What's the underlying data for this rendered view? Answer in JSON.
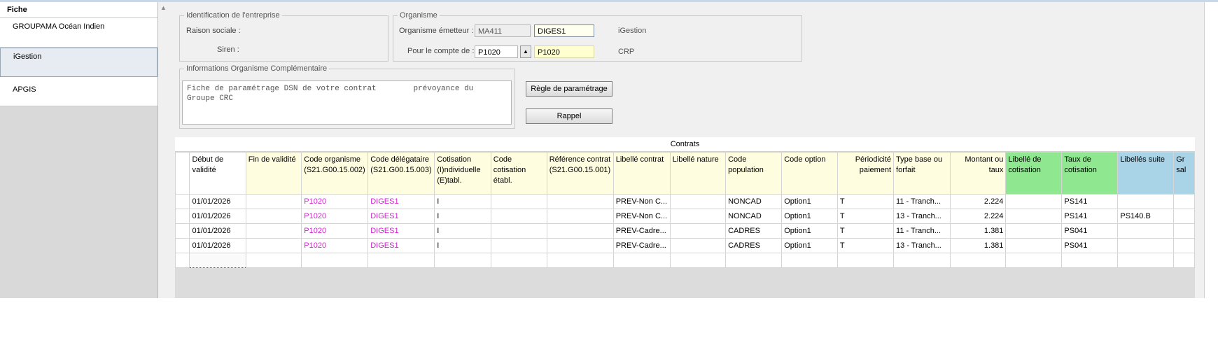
{
  "left_panel": {
    "header": "Fiche",
    "items": [
      {
        "label": "GROUPAMA Océan Indien",
        "selected": false
      },
      {
        "label": "iGestion",
        "selected": true
      },
      {
        "label": "APGIS",
        "selected": false
      }
    ]
  },
  "company": {
    "legend": "Identification de l'entreprise",
    "raison_sociale_label": "Raison sociale :",
    "siren_label": "Siren :"
  },
  "organisme": {
    "legend": "Organisme",
    "emetteur_label": "Organisme émetteur :",
    "emetteur_code": "MA411",
    "emetteur_value": "DIGES1",
    "emetteur_name": "iGestion",
    "compte_label": "Pour le compte de :",
    "compte_code": "P1020",
    "compte_value": "P1020",
    "compte_name": "CRP"
  },
  "info": {
    "legend": "Informations Organisme Complémentaire",
    "text": "Fiche de paramétrage DSN de votre contrat        prévoyance du\nGroupe CRC"
  },
  "buttons": {
    "regle": "Règle de paramétrage",
    "rappel": "Rappel"
  },
  "grid": {
    "title": "Contrats",
    "columns": [
      {
        "label": "",
        "color": "white"
      },
      {
        "label": "Début de validité",
        "color": "white"
      },
      {
        "label": "Fin de validité",
        "color": "yellow"
      },
      {
        "label": "Code organisme (S21.G00.15.002)",
        "color": "yellow"
      },
      {
        "label": "Code délégataire (S21.G00.15.003)",
        "color": "yellow"
      },
      {
        "label": "Cotisation (I)ndividuelle (E)tabl.",
        "color": "yellow"
      },
      {
        "label": "Code cotisation établ.",
        "color": "yellow"
      },
      {
        "label": "Référence contrat (S21.G00.15.001)",
        "color": "yellow"
      },
      {
        "label": "Libellé contrat",
        "color": "yellow"
      },
      {
        "label": "Libellé nature",
        "color": "yellow"
      },
      {
        "label": "Code population",
        "color": "yellow"
      },
      {
        "label": "Code option",
        "color": "yellow"
      },
      {
        "label": "Périodicité paiement",
        "color": "yellow"
      },
      {
        "label": "Type base ou forfait",
        "color": "yellow"
      },
      {
        "label": "Montant ou taux",
        "color": "yellow"
      },
      {
        "label": "Libellé de cotisation",
        "color": "green"
      },
      {
        "label": "Taux de cotisation",
        "color": "green"
      },
      {
        "label": "Libellés suite",
        "color": "blue"
      },
      {
        "label": "Gr sal",
        "color": "blue"
      }
    ],
    "rows": [
      [
        "",
        "01/01/2026",
        "",
        "P1020",
        "DIGES1",
        "I",
        "",
        "",
        "PREV-Non C...",
        "",
        "NONCAD",
        "Option1",
        "T",
        "11 - Tranch...",
        "2.224",
        "",
        "PS141",
        "",
        ""
      ],
      [
        "",
        "01/01/2026",
        "",
        "P1020",
        "DIGES1",
        "I",
        "",
        "",
        "PREV-Non C...",
        "",
        "NONCAD",
        "Option1",
        "T",
        "13 - Tranch...",
        "2.224",
        "",
        "PS141",
        "PS140.B",
        ""
      ],
      [
        "",
        "01/01/2026",
        "",
        "P1020",
        "DIGES1",
        "I",
        "",
        "",
        "PREV-Cadre...",
        "",
        "CADRES",
        "Option1",
        "T",
        "11 - Tranch...",
        "1.381",
        "",
        "PS041",
        "",
        ""
      ],
      [
        "",
        "01/01/2026",
        "",
        "P1020",
        "DIGES1",
        "I",
        "",
        "",
        "PREV-Cadre...",
        "",
        "CADRES",
        "Option1",
        "T",
        "13 - Tranch...",
        "1.381",
        "",
        "PS041",
        "",
        ""
      ],
      [
        "",
        "",
        "",
        "",
        "",
        "",
        "",
        "",
        "",
        "",
        "",
        "",
        "",
        "",
        "",
        "",
        "",
        "",
        ""
      ]
    ]
  }
}
